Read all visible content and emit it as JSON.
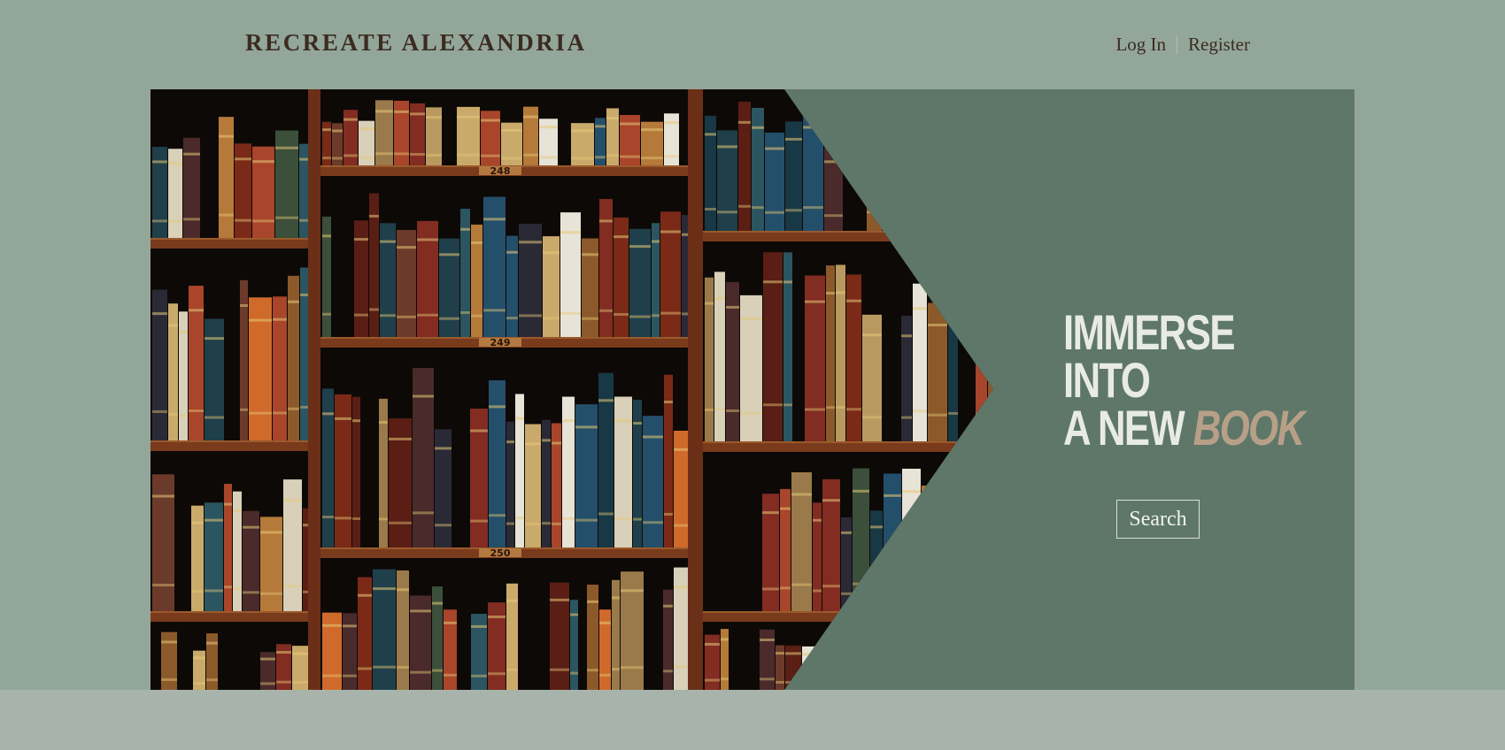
{
  "header": {
    "brand": "RECREATE ALEXANDRIA",
    "login_label": "Log In",
    "register_label": "Register"
  },
  "hero": {
    "image": "bookshelf-photo",
    "tagline_line1": "IMMERSE",
    "tagline_line2": "INTO",
    "tagline_line3_prefix": "A NEW",
    "tagline_line3_accent": "BOOK",
    "search_label": "Search",
    "shelf_labels": [
      "248",
      "249",
      "250"
    ]
  },
  "colors": {
    "background": "#93a69a",
    "panel": "#5e7769",
    "brand_text": "#3b2b20",
    "accent_word": "#b8a088",
    "footer_band": "#a8b4ab"
  }
}
